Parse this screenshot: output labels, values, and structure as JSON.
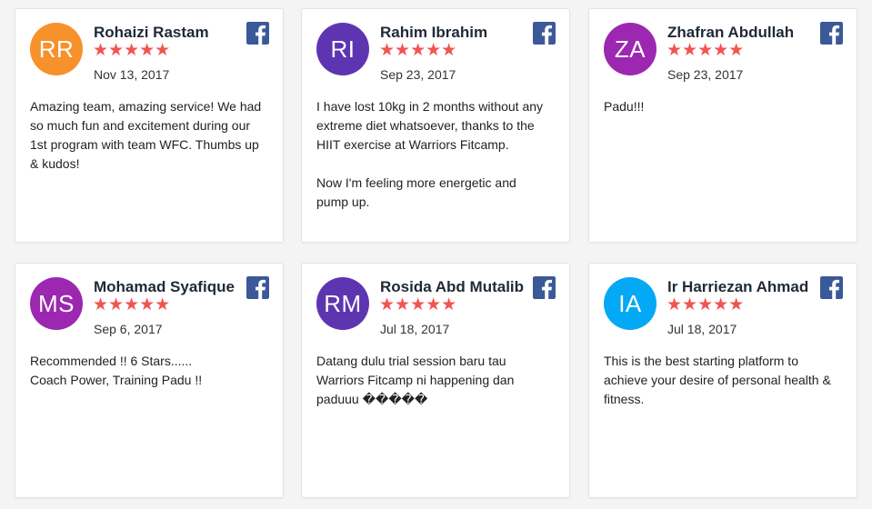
{
  "reviews": [
    {
      "initials": "RR",
      "avatar_color": "#f7912b",
      "name": "Rohaizi Rastam",
      "stars": "★★★★★",
      "date": "Nov 13, 2017",
      "text": "Amazing team, amazing service! We had so much fun and excitement during our 1st program with team WFC. Thumbs up & kudos!"
    },
    {
      "initials": "RI",
      "avatar_color": "#5e35b1",
      "name": "Rahim Ibrahim",
      "stars": "★★★★★",
      "date": "Sep 23, 2017",
      "text": "I have lost 10kg in 2 months without any extreme diet whatsoever, thanks to the HIIT exercise at Warriors Fitcamp.\n\nNow I'm feeling more energetic and pump up."
    },
    {
      "initials": "ZA",
      "avatar_color": "#9c27b0",
      "name": "Zhafran Abdullah",
      "stars": "★★★★★",
      "date": "Sep 23, 2017",
      "text": "Padu!!!"
    },
    {
      "initials": "MS",
      "avatar_color": "#9c27b0",
      "name": "Mohamad Syafique",
      "stars": "★★★★★",
      "date": "Sep 6, 2017",
      "text": "Recommended !! 6 Stars......\nCoach Power, Training Padu !!"
    },
    {
      "initials": "RM",
      "avatar_color": "#5e35b1",
      "name": "Rosida Abd Mutalib",
      "stars": "★★★★★",
      "date": "Jul 18, 2017",
      "text": "Datang dulu trial session baru tau Warriors Fitcamp ni happening dan paduuu �����"
    },
    {
      "initials": "IA",
      "avatar_color": "#03a9f4",
      "name": "Ir Harriezan Ahmad",
      "stars": "★★★★★",
      "date": "Jul 18, 2017",
      "text": "This is the best starting platform to achieve your desire of personal health & fitness."
    }
  ],
  "colors": {
    "star": "#f0554e",
    "facebook": "#3b5998"
  },
  "icons": {
    "source": "facebook-icon"
  }
}
